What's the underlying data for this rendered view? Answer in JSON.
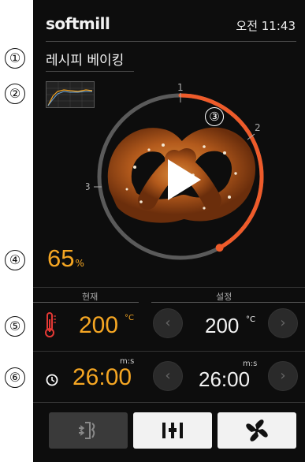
{
  "callouts": [
    "①",
    "②",
    "③",
    "④",
    "⑤",
    "⑥"
  ],
  "header": {
    "brand_soft": "soft",
    "brand_mill": "mill",
    "time": "오전 11:43"
  },
  "recipe": {
    "title": "레시피 베이킹"
  },
  "ring": {
    "step1": "1",
    "step2": "2",
    "step3": "3",
    "progress_fraction": 0.42
  },
  "progress": {
    "value": "65",
    "unit": "%"
  },
  "panels": {
    "current_label": "현재",
    "setting_label": "설정"
  },
  "temperature": {
    "current": "200",
    "setting": "200",
    "unit": "°C"
  },
  "timer": {
    "current": "26:00",
    "setting": "26:00",
    "unit": "m:s"
  },
  "icons": {
    "decrease": "‹",
    "increase": "›"
  },
  "colors": {
    "accent": "#f5a623",
    "ring_active": "#ee5b2a",
    "ring_idle": "#5a5a5a"
  }
}
